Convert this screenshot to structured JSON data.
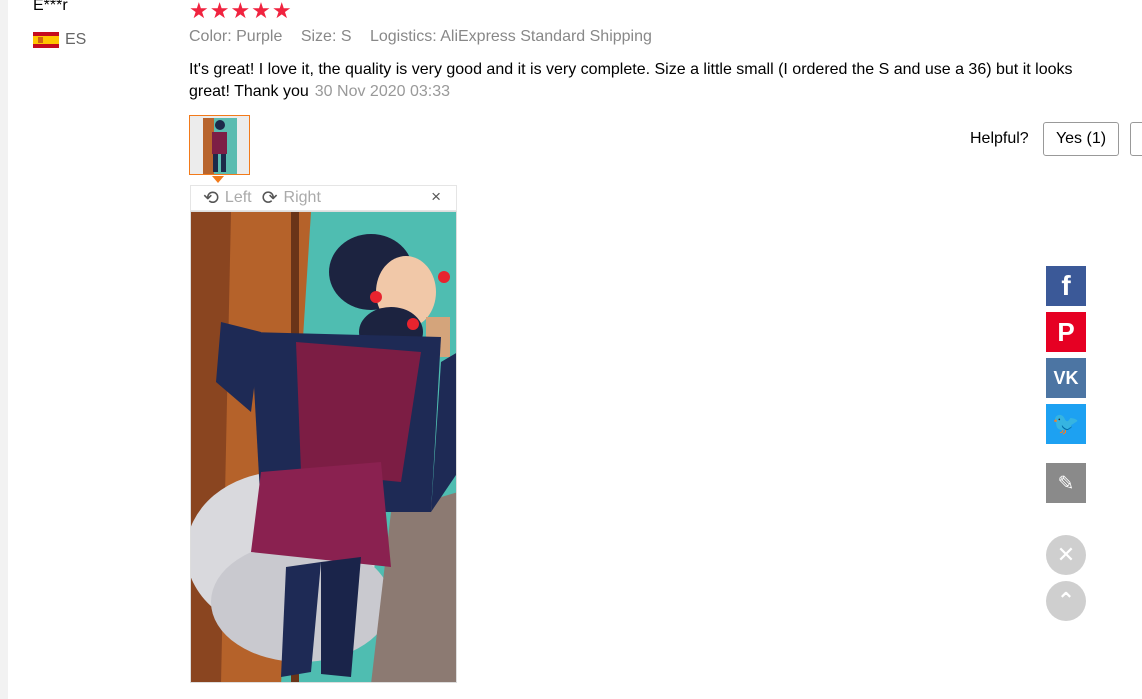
{
  "review": {
    "reviewer": "E***r",
    "country_code": "ES",
    "rating_stars": "★★★★★",
    "rating": 5,
    "color": "Color: Purple",
    "size": "Size: S",
    "logistics": "Logistics: AliExpress Standard Shipping",
    "text": "It's great! I love it, the quality is very good and it is very complete. Size a little small (I ordered the S and use a 36) but it looks great! Thank you",
    "date": "30 Nov 2020 03:33"
  },
  "helpful": {
    "label": "Helpful?",
    "yes_label": "Yes (1)"
  },
  "viewer": {
    "rotate_left": "Left",
    "rotate_right": "Right",
    "close_glyph": "×"
  },
  "side_tools": {
    "facebook_glyph": "f",
    "pinterest_glyph": "P",
    "vk_glyph": "VK",
    "twitter_glyph": "🐦",
    "edit_glyph": "✎",
    "close_glyph": "✕",
    "top_glyph": "⌃"
  },
  "colors": {
    "accent_orange": "#f27a1a",
    "star_red": "#f0233f",
    "facebook": "#3b5998",
    "pinterest": "#e60023",
    "vk": "#4c75a3",
    "twitter": "#1da1f2"
  }
}
